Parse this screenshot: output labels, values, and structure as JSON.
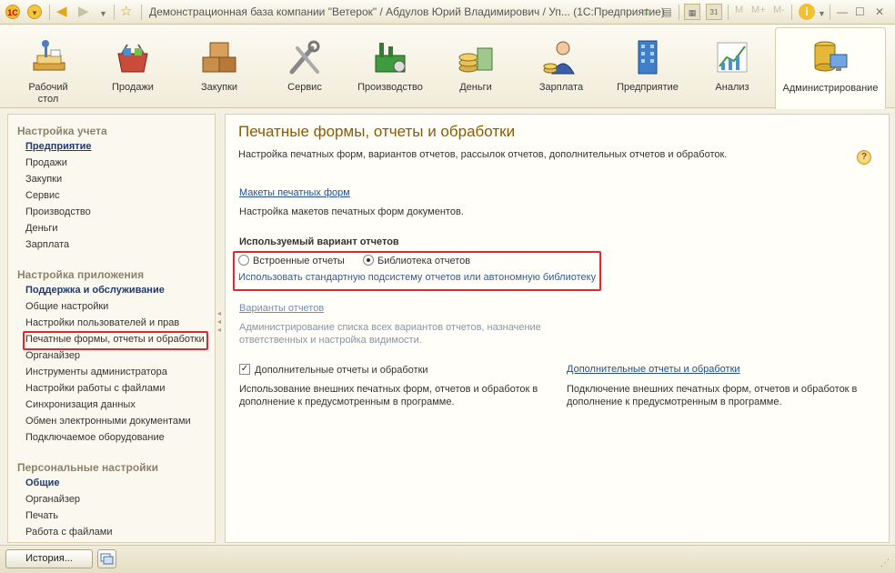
{
  "window": {
    "title": "Демонстрационная база компании \"Ветерок\" / Абдулов Юрий Владимирович / Уп...  (1С:Предприятие)",
    "logo_text": "1С",
    "calendar_text": "31",
    "info_text": "i",
    "minimize_label": "M",
    "maximize_label": "M+",
    "restore_label": "M-",
    "close_label": "✕"
  },
  "sections": [
    {
      "label": "Рабочий\nстол",
      "icon": "desktop-icon"
    },
    {
      "label": "Продажи",
      "icon": "shopping-basket-icon"
    },
    {
      "label": "Закупки",
      "icon": "boxes-icon"
    },
    {
      "label": "Сервис",
      "icon": "tools-icon"
    },
    {
      "label": "Производство",
      "icon": "factory-icon"
    },
    {
      "label": "Деньги",
      "icon": "coins-icon"
    },
    {
      "label": "Зарплата",
      "icon": "worker-icon"
    },
    {
      "label": "Предприятие",
      "icon": "building-icon"
    },
    {
      "label": "Анализ",
      "icon": "chart-icon"
    },
    {
      "label": "Администрирование",
      "icon": "server-icon"
    }
  ],
  "nav": {
    "groups": [
      {
        "title": "Настройка учета",
        "items": [
          "Предприятие",
          "Продажи",
          "Закупки",
          "Сервис",
          "Производство",
          "Деньги",
          "Зарплата"
        ]
      },
      {
        "title": "Настройка приложения",
        "items": [
          "Поддержка и обслуживание",
          "Общие настройки",
          "Настройки пользователей и прав",
          "Печатные формы, отчеты и обработки",
          "Органайзер",
          "Инструменты администратора",
          "Настройки работы с файлами",
          "Синхронизация данных",
          "Обмен электронными документами",
          "Подключаемое оборудование"
        ]
      },
      {
        "title": "Персональные настройки",
        "items": [
          "Общие",
          "Органайзер",
          "Печать",
          "Работа с файлами"
        ]
      }
    ]
  },
  "main": {
    "title": "Печатные формы, отчеты и обработки",
    "description": "Настройка печатных форм, вариантов отчетов, рассылок отчетов, дополнительных отчетов и обработок.",
    "help_label": "?",
    "print_layouts_link": "Макеты печатных форм",
    "print_layouts_desc": "Настройка макетов печатных форм документов.",
    "report_variant_heading": "Используемый вариант отчетов",
    "radio_builtin": "Встроенные отчеты",
    "radio_library": "Библиотека отчетов",
    "radio_selected": "library",
    "radio_desc": "Использовать стандартную подсистему отчетов или автономную библиотеку",
    "report_variants_link": "Варианты отчетов",
    "report_variants_desc": "Администрирование списка всех вариантов отчетов, назначение ответственных и настройка видимости.",
    "additional_checkbox": "Дополнительные отчеты и обработки",
    "additional_checked": true,
    "additional_desc": "Использование внешних печатных форм, отчетов и обработок в дополнение к предусмотренным в программе.",
    "additional_link": "Дополнительные отчеты и обработки",
    "additional_link_desc": "Подключение внешних печатных форм, отчетов и обработок в дополнение к предусмотренным в программе."
  },
  "bottom": {
    "history_button": "История..."
  }
}
